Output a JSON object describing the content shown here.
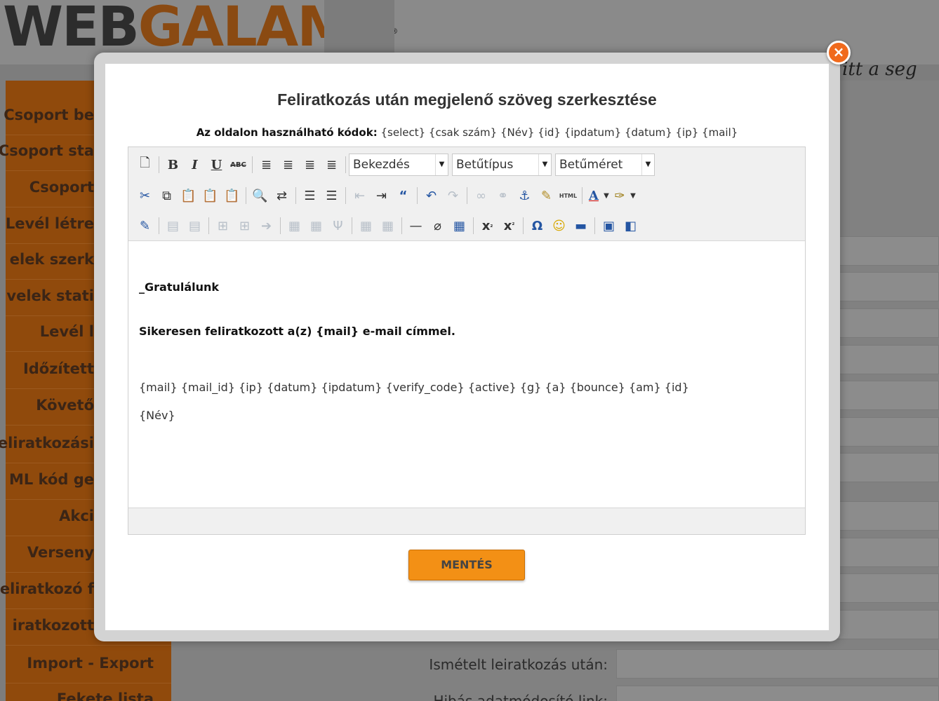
{
  "background": {
    "logo_part1": "WEB",
    "logo_part2": "GALAMB",
    "logo_reg": "®",
    "tagline": "itt a seg",
    "sidebar_items": [
      "Csoport be",
      "Csoport sta",
      "Csoport",
      "Levél létre",
      "elek szerk",
      "velek stati",
      "Levél l",
      "Időzített",
      "Követő",
      "eliratkozási",
      "ML kód ge",
      "Akci",
      "Verseny",
      "eliratkozó f",
      "iratkozott",
      "Import - Export",
      "Fekete lista"
    ],
    "form_labels": [
      "Ismételt leiratkozás után:",
      "Hibás adatmódosító link:"
    ]
  },
  "modal": {
    "close_label": "×",
    "title": "Feliratkozás után megjelenő szöveg szerkesztése",
    "codes_label": "Az oldalon használható kódok:",
    "codes_value": "{select} {csak szám} {Név} {id} {ipdatum} {datum} {ip} {mail}",
    "save_label": "MENTÉS"
  },
  "editor": {
    "toolbar": {
      "format_select": "Bekezdés",
      "font_select": "Betűtípus",
      "size_select": "Betűméret",
      "bold": "B",
      "italic": "I",
      "underline": "U",
      "strike": "ABC",
      "html_label": "HTML",
      "font_color": "A",
      "omega": "Ω",
      "subscript": "x",
      "superscript": "x"
    },
    "content": {
      "line1": "_Gratulálunk",
      "line2": "Sikeresen feliratkozott a(z) {mail} e-mail címmel.",
      "line3": "{mail} {mail_id} {ip} {datum} {ipdatum} {verify_code} {active} {g} {a} {bounce} {am} {id}",
      "line4": "{Név}"
    }
  },
  "colors": {
    "accent_orange": "#f39015",
    "close_orange": "#f06a1d",
    "sidebar_brown": "#904a0c"
  }
}
